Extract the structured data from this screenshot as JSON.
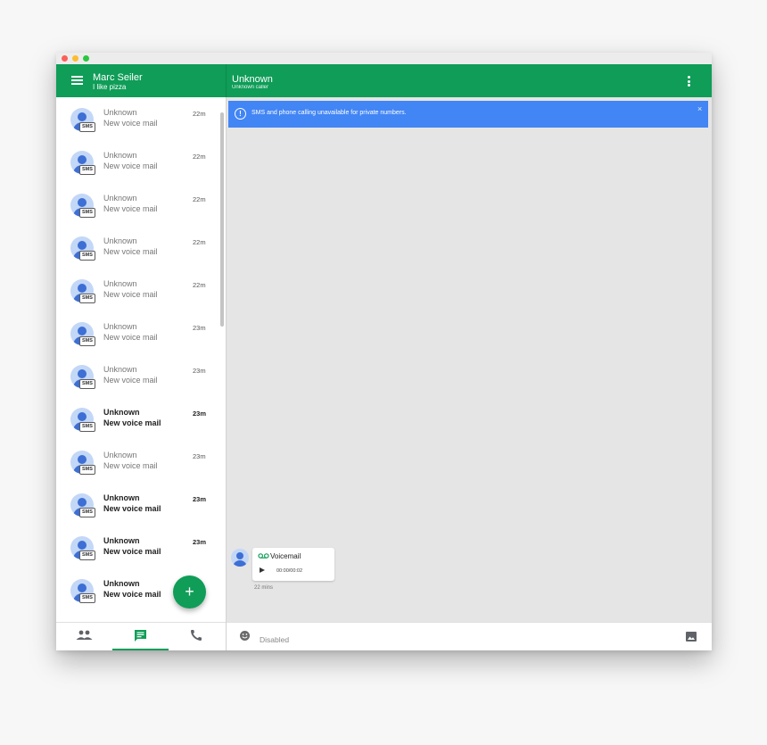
{
  "colors": {
    "primary": "#0f9d58",
    "banner": "#4285f4",
    "avatar_bg": "#c3d7f7",
    "avatar_fg": "#3d6fd4"
  },
  "account": {
    "name": "Marc Seiler",
    "status": "I like pizza"
  },
  "conversation": {
    "title": "Unknown",
    "subtitle": "Unknown caller"
  },
  "banner": {
    "icon": "info-circle-icon",
    "text": "SMS and phone calling unavailable for private numbers.",
    "close": "×"
  },
  "list": {
    "badge": "SMS",
    "items": [
      {
        "name": "Unknown",
        "message": "New voice mail",
        "time": "22m",
        "unread": false
      },
      {
        "name": "Unknown",
        "message": "New voice mail",
        "time": "22m",
        "unread": false
      },
      {
        "name": "Unknown",
        "message": "New voice mail",
        "time": "22m",
        "unread": false
      },
      {
        "name": "Unknown",
        "message": "New voice mail",
        "time": "22m",
        "unread": false
      },
      {
        "name": "Unknown",
        "message": "New voice mail",
        "time": "22m",
        "unread": false
      },
      {
        "name": "Unknown",
        "message": "New voice mail",
        "time": "23m",
        "unread": false
      },
      {
        "name": "Unknown",
        "message": "New voice mail",
        "time": "23m",
        "unread": false
      },
      {
        "name": "Unknown",
        "message": "New voice mail",
        "time": "23m",
        "unread": true
      },
      {
        "name": "Unknown",
        "message": "New voice mail",
        "time": "23m",
        "unread": false
      },
      {
        "name": "Unknown",
        "message": "New voice mail",
        "time": "23m",
        "unread": true
      },
      {
        "name": "Unknown",
        "message": "New voice mail",
        "time": "23m",
        "unread": true
      },
      {
        "name": "Unknown",
        "message": "New voice mail",
        "time": "",
        "unread": true
      }
    ]
  },
  "fab": {
    "label": "+",
    "icon": "plus-icon"
  },
  "bottom_nav": {
    "tabs": [
      {
        "icon": "contacts-icon",
        "active": false
      },
      {
        "icon": "message-icon",
        "active": true
      },
      {
        "icon": "phone-icon",
        "active": false
      }
    ]
  },
  "voicemail": {
    "label": "Voicemail",
    "progress": "00:00/00:02",
    "time": "22 mins"
  },
  "compose": {
    "placeholder": "Disabled",
    "emoji_icon": "emoji-icon",
    "image_icon": "image-icon"
  }
}
